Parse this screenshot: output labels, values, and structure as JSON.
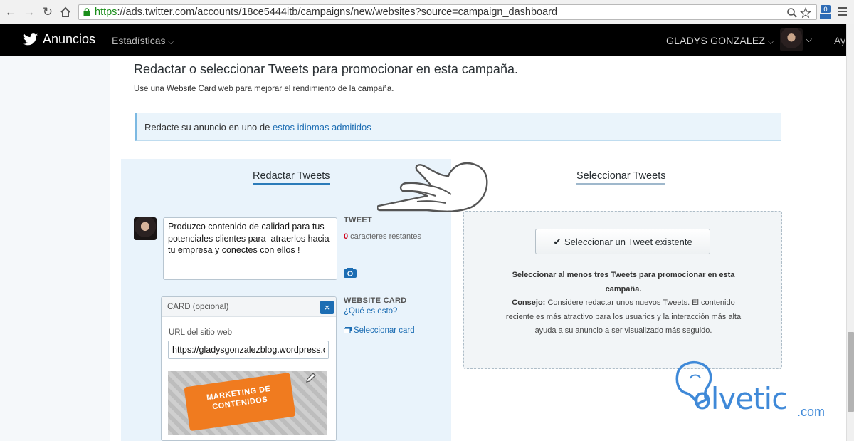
{
  "browser": {
    "url_scheme": "https",
    "url_rest": "://ads.twitter.com/accounts/18ce5444itb/campaigns/new/websites?source=campaign_dashboard",
    "icons": [
      "back-icon",
      "forward-icon",
      "reload-icon",
      "home-icon",
      "lock-icon",
      "zoom-icon",
      "star-icon",
      "extension-icon",
      "menu-icon"
    ]
  },
  "topbar": {
    "brand": "Anuncios",
    "stats_menu": "Estadísticas",
    "user_menu": "GLADYS GONZALEZ",
    "help_menu": "Ay"
  },
  "page": {
    "heading": "Redactar o seleccionar Tweets para promocionar en esta campaña.",
    "subheading": "Use una Website Card web para mejorar el rendimiento de la campaña.",
    "lang_banner_text": "Redacte su anuncio en uno de ",
    "lang_banner_link": "estos idiomas admitidos"
  },
  "compose": {
    "tab_label": "Redactar Tweets",
    "tweet_text": "Produzco contenido de calidad para tus potenciales clientes para  atraerlos hacia tu empresa y conectes con ellos !",
    "tweet_label": "TWEET",
    "char_count": "0",
    "char_suffix": " caracteres restantes",
    "card": {
      "title": "CARD (opcional)",
      "close": "×",
      "url_label": "URL del sitio web",
      "url_value": "https://gladysgonzalezblog.wordpress.com",
      "image_text": "MARKETING DE CONTENIDOS"
    },
    "website_card_label": "WEBSITE CARD",
    "website_card_help": "¿Qué es esto?",
    "website_card_select": "Seleccionar card"
  },
  "select": {
    "tab_label": "Seleccionar Tweets",
    "button_label": "Seleccionar un Tweet existente",
    "info_bold": "Seleccionar al menos tres Tweets para promocionar en esta campaña.",
    "tip_label": "Consejo:",
    "tip_text": " Considere redactar unos nuevos Tweets. El contenido reciente es más atractivo para los usuarios y la interacción más alta ayuda a su anuncio a ser visualizado más seguido."
  },
  "watermark": {
    "text": "olvetic",
    "suffix": ".com"
  },
  "colors": {
    "link": "#1c6db3",
    "tab_active": "#2b7bb9",
    "compose_bg": "#e9f3fb",
    "counter_red": "#d0021b",
    "watermark": "#3f89d8"
  }
}
